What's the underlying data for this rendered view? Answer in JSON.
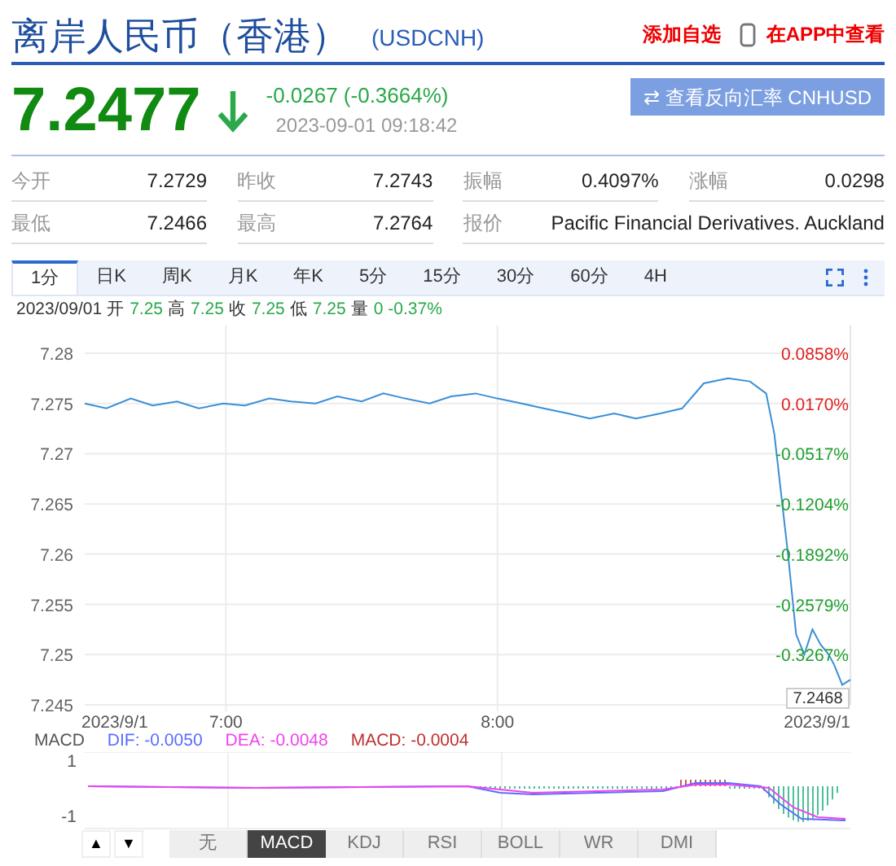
{
  "header": {
    "title": "离岸人民币（香港）",
    "code": "(USDCNH)",
    "add_watchlist": "添加自选",
    "app_link": "在APP中查看"
  },
  "quote": {
    "price": "7.2477",
    "change": "-0.0267 (-0.3664%)",
    "time": "2023-09-01 09:18:42",
    "reverse_button": "⇄ 查看反向汇率 CNHUSD"
  },
  "stats": [
    {
      "label": "今开",
      "value": "7.2729"
    },
    {
      "label": "昨收",
      "value": "7.2743"
    },
    {
      "label": "振幅",
      "value": "0.4097%"
    },
    {
      "label": "涨幅",
      "value": "0.0298"
    },
    {
      "label": "最低",
      "value": "7.2466"
    },
    {
      "label": "最高",
      "value": "7.2764"
    },
    {
      "label": "报价",
      "value": "Pacific Financial Derivatives. Auckland"
    }
  ],
  "period_tabs": [
    {
      "label": "1分",
      "selected": true
    },
    {
      "label": "日K",
      "selected": false
    },
    {
      "label": "周K",
      "selected": false
    },
    {
      "label": "月K",
      "selected": false
    },
    {
      "label": "年K",
      "selected": false
    },
    {
      "label": "5分",
      "selected": false
    },
    {
      "label": "15分",
      "selected": false
    },
    {
      "label": "30分",
      "selected": false
    },
    {
      "label": "60分",
      "selected": false
    },
    {
      "label": "4H",
      "selected": false
    }
  ],
  "bar_info": {
    "date": "2023/09/01",
    "items": [
      {
        "label": "开",
        "value": "7.25"
      },
      {
        "label": "高",
        "value": "7.25"
      },
      {
        "label": "收",
        "value": "7.25"
      },
      {
        "label": "低",
        "value": "7.25"
      },
      {
        "label": "量",
        "value": "0"
      }
    ],
    "change": "-0.37%"
  },
  "chart": {
    "chart_data": {
      "type": "line",
      "x": [
        6.48,
        6.56,
        6.65,
        6.73,
        6.82,
        6.9,
        6.99,
        7.07,
        7.16,
        7.24,
        7.33,
        7.41,
        7.5,
        7.58,
        7.66,
        7.75,
        7.83,
        7.92,
        8.0,
        8.09,
        8.17,
        8.26,
        8.34,
        8.43,
        8.51,
        8.6,
        8.68,
        8.76,
        8.85,
        8.93,
        8.99,
        9.02,
        9.07,
        9.1,
        9.13,
        9.16,
        9.19,
        9.22,
        9.24,
        9.27,
        9.3
      ],
      "series": [
        {
          "color": "#3a8fd6",
          "values": [
            7.275,
            7.2745,
            7.2755,
            7.2748,
            7.2752,
            7.2745,
            7.275,
            7.2748,
            7.2755,
            7.2752,
            7.275,
            7.2757,
            7.2752,
            7.276,
            7.2755,
            7.275,
            7.2757,
            7.276,
            7.2755,
            7.275,
            7.2745,
            7.274,
            7.2735,
            7.274,
            7.2735,
            7.274,
            7.2745,
            7.277,
            7.2775,
            7.2772,
            7.276,
            7.272,
            7.26,
            7.252,
            7.25,
            7.2525,
            7.251,
            7.25,
            7.249,
            7.247,
            7.2475
          ]
        }
      ],
      "grid": true,
      "xlim": [
        6.48,
        9.3
      ],
      "ylim": [
        7.245,
        7.28
      ],
      "xticks": [
        {
          "value": 6.48,
          "label": "2023/9/1"
        },
        {
          "value": 7,
          "label": "7:00"
        },
        {
          "value": 8,
          "label": "8:00"
        },
        {
          "value": 9.3,
          "label": "2023/9/1"
        }
      ],
      "yticks": [
        {
          "value": 7.28,
          "label": "7.28"
        },
        {
          "value": 7.275,
          "label": "7.275"
        },
        {
          "value": 7.27,
          "label": "7.27"
        },
        {
          "value": 7.265,
          "label": "7.265"
        },
        {
          "value": 7.26,
          "label": "7.26"
        },
        {
          "value": 7.255,
          "label": "7.255"
        },
        {
          "value": 7.25,
          "label": "7.25"
        },
        {
          "value": 7.245,
          "label": "7.245"
        }
      ]
    },
    "percent_labels": [
      {
        "text": "0.0858%",
        "color": "#e02020"
      },
      {
        "text": "0.0170%",
        "color": "#e02020"
      },
      {
        "text": "-0.0517%",
        "color": "#1fa02f"
      },
      {
        "text": "-0.1204%",
        "color": "#1fa02f"
      },
      {
        "text": "-0.1892%",
        "color": "#1fa02f"
      },
      {
        "text": "-0.2579%",
        "color": "#1fa02f"
      },
      {
        "text": "-0.3267%",
        "color": "#1fa02f"
      }
    ],
    "last_price_tag": "7.2468"
  },
  "macd": {
    "title": "MACD",
    "dif": "DIF: -0.0050",
    "dea": "DEA: -0.0048",
    "macd": "MACD: -0.0004",
    "scale": [
      "1",
      "-1"
    ]
  },
  "indicator_tabs": [
    {
      "label": "无",
      "selected": false
    },
    {
      "label": "MACD",
      "selected": true
    },
    {
      "label": "KDJ",
      "selected": false
    },
    {
      "label": "RSI",
      "selected": false
    },
    {
      "label": "BOLL",
      "selected": false
    },
    {
      "label": "WR",
      "selected": false
    },
    {
      "label": "DMI",
      "selected": false
    }
  ],
  "arrow_buttons": [
    "▲",
    "▼"
  ]
}
